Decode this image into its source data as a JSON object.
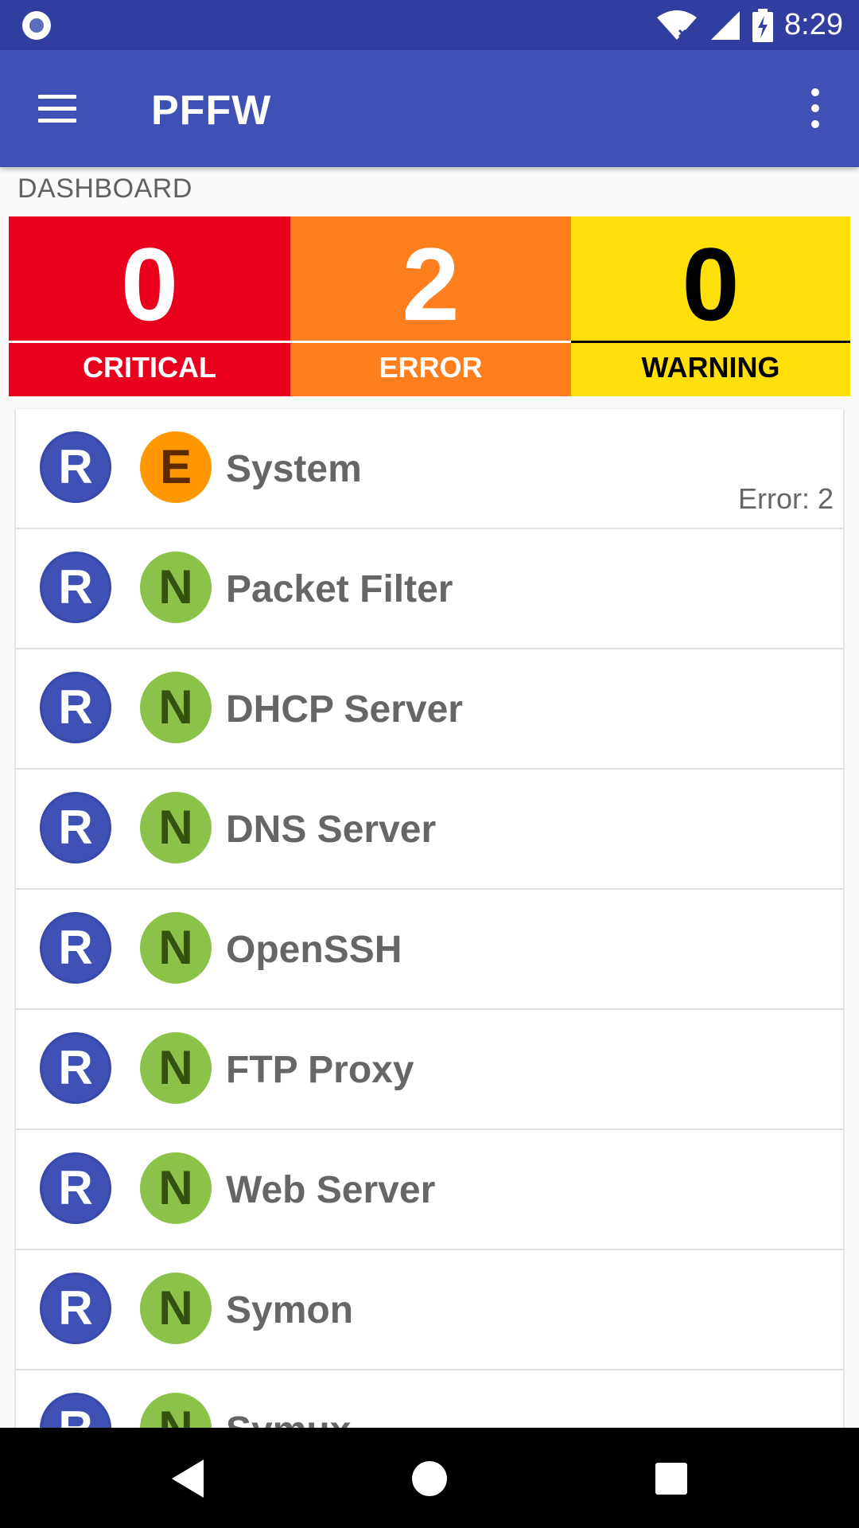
{
  "status_bar": {
    "time": "8:29",
    "icons": [
      "notification-icon",
      "wifi-icon",
      "signal-icon",
      "battery-charging-icon"
    ]
  },
  "app_bar": {
    "title": "PFFW",
    "menu_icon": "hamburger-menu-icon",
    "overflow_icon": "more-vert-icon"
  },
  "dashboard": {
    "label": "DASHBOARD",
    "tiles": [
      {
        "count": "0",
        "label": "CRITICAL",
        "bg": "#e8001c",
        "fg": "#ffffff"
      },
      {
        "count": "2",
        "label": "ERROR",
        "bg": "#ff7f1e",
        "fg": "#ffffff"
      },
      {
        "count": "0",
        "label": "WARNING",
        "bg": "#ffe00a",
        "fg": "#000000"
      }
    ]
  },
  "services": [
    {
      "run": "R",
      "state": "E",
      "name": "System",
      "status": "Error: 2"
    },
    {
      "run": "R",
      "state": "N",
      "name": "Packet Filter",
      "status": ""
    },
    {
      "run": "R",
      "state": "N",
      "name": "DHCP Server",
      "status": ""
    },
    {
      "run": "R",
      "state": "N",
      "name": "DNS Server",
      "status": ""
    },
    {
      "run": "R",
      "state": "N",
      "name": "OpenSSH",
      "status": ""
    },
    {
      "run": "R",
      "state": "N",
      "name": "FTP Proxy",
      "status": ""
    },
    {
      "run": "R",
      "state": "N",
      "name": "Web Server",
      "status": ""
    },
    {
      "run": "R",
      "state": "N",
      "name": "Symon",
      "status": ""
    },
    {
      "run": "R",
      "state": "N",
      "name": "Symux",
      "status": ""
    }
  ],
  "nav_bar": {
    "buttons": [
      "back-icon",
      "home-icon",
      "recents-icon"
    ]
  },
  "colors": {
    "primary": "#3f51b5",
    "primary_dark": "#303f9f",
    "state_normal": "#8bc34a",
    "state_error": "#ff9800"
  }
}
